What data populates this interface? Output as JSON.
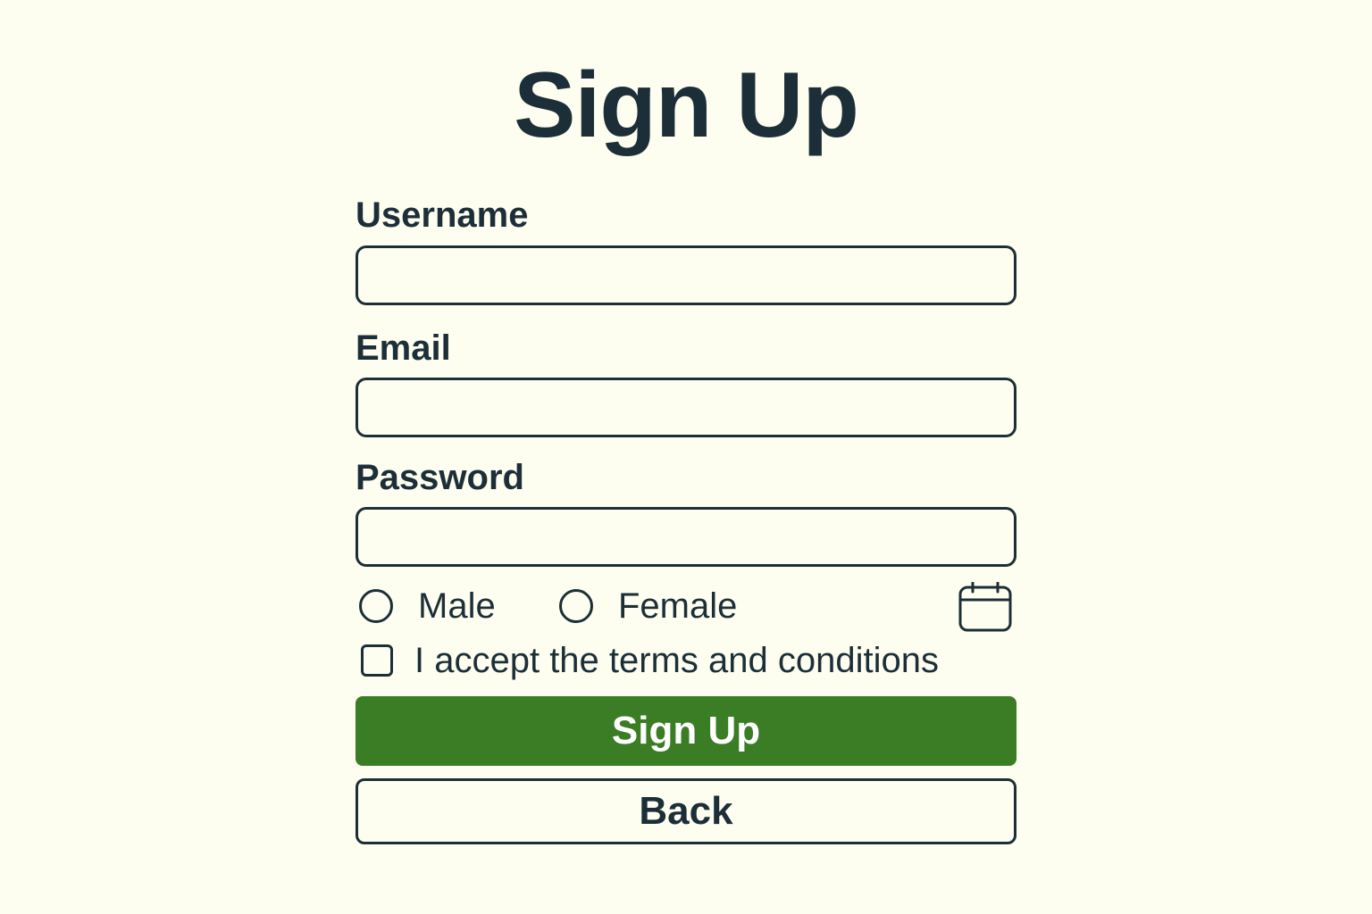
{
  "page": {
    "title": "Sign Up"
  },
  "form": {
    "username": {
      "label": "Username",
      "value": "",
      "placeholder": ""
    },
    "email": {
      "label": "Email",
      "value": "",
      "placeholder": ""
    },
    "password": {
      "label": "Password",
      "value": "",
      "placeholder": ""
    },
    "gender": {
      "options": [
        {
          "label": "Male",
          "selected": false
        },
        {
          "label": "Female",
          "selected": false
        }
      ]
    },
    "date_picker": {
      "icon": "calendar-icon"
    },
    "terms": {
      "label": "I accept the terms and conditions",
      "checked": false
    }
  },
  "actions": {
    "submit_label": "Sign Up",
    "back_label": "Back"
  },
  "colors": {
    "background": "#fefef0",
    "text": "#1c2f38",
    "primary": "#3a7d25",
    "primary_text": "#ffffff"
  }
}
